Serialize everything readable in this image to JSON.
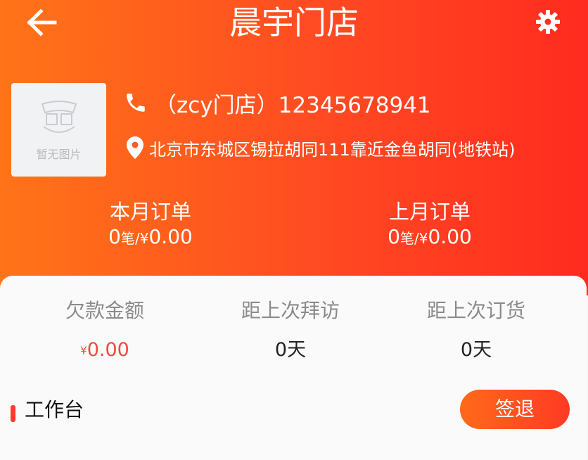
{
  "topbar": {
    "title": "晨宇门店",
    "back_icon": "arrow-left-icon",
    "settings_icon": "gear-icon"
  },
  "store": {
    "image_placeholder": "暂无图片",
    "logo_icon": "store-logo-icon",
    "phone_icon": "phone-icon",
    "phone": "（zcy门店）12345678941",
    "location_icon": "location-pin-icon",
    "address": "北京市东城区锡拉胡同111靠近金鱼胡同(地铁站)"
  },
  "orders": {
    "this_month": {
      "label": "本月订单",
      "count": "0",
      "unit": "笔/",
      "currency": "¥",
      "amount": "0.00"
    },
    "last_month": {
      "label": "上月订单",
      "count": "0",
      "unit": "笔/",
      "currency": "¥",
      "amount": "0.00"
    }
  },
  "stats": {
    "debt": {
      "label": "欠款金额",
      "currency": "¥",
      "value": "0.00"
    },
    "last_visit": {
      "label": "距上次拜访",
      "value": "0天"
    },
    "last_order": {
      "label": "距上次订货",
      "value": "0天"
    }
  },
  "workbench": {
    "label": "工作台"
  },
  "actions": {
    "sign_out": "签退"
  },
  "colors": {
    "gradient_start": "#ff7418",
    "gradient_end": "#ff2b1f",
    "accent_red": "#f04a3b"
  }
}
